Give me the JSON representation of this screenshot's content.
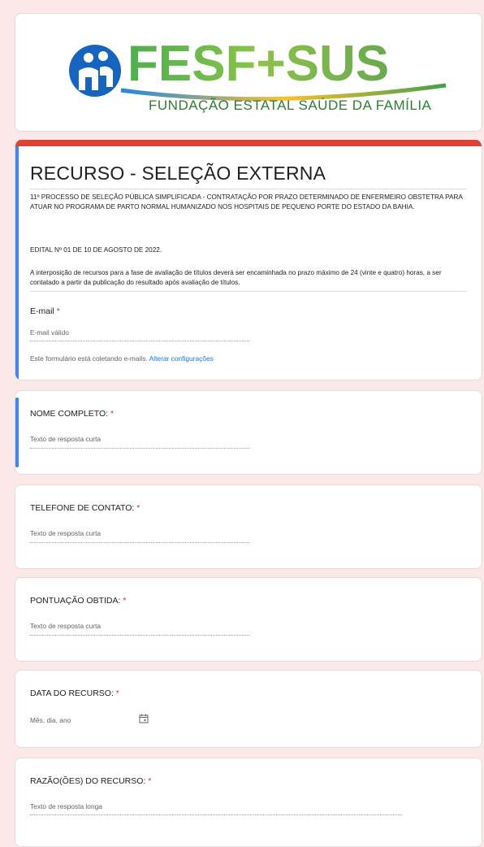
{
  "header": {
    "logo_text": "FESF+SUS",
    "logo_subtitle": "FUNDAÇÃO ESTATAL SAÚDE DA FAMÍLIA"
  },
  "form": {
    "title": "RECURSO - SELEÇÃO EXTERNA",
    "description_1": "11º PROCESSO DE SELEÇÃO PÚBLICA SIMPLIFICADA - CONTRATAÇÃO POR PRAZO DETERMINADO DE ENFERMEIRO OBSTETRA PARA ATUAR NO PROGRAMA DE PARTO NORMAL HUMANIZADO NOS HOSPITAIS DE PEQUENO PORTE DO ESTADO DA BAHIA.",
    "description_2": "EDITAL Nº 01 DE 10 DE AGOSTO DE 2022.",
    "description_3": "A interposição de recursos para a fase de avaliação de títulos deverá ser encaminhada no prazo máximo de 24 (vinte e quatro) horas, a ser contatado a partir da publicação do resultado após avaliação de títulos.",
    "email_label": "E-mail",
    "email_placeholder": "E-mail válido",
    "collecting_note": "Este formulário está coletando e-mails.",
    "change_settings": "Alterar configurações",
    "required_mark": "*"
  },
  "questions": [
    {
      "label": "NOME COMPLETO:",
      "placeholder": "Texto de resposta curta"
    },
    {
      "label": "TELEFONE DE CONTATO:",
      "placeholder": "Texto de resposta curta"
    },
    {
      "label": "PONTUAÇÃO OBTIDA:",
      "placeholder": "Texto de resposta curta"
    },
    {
      "label": "DATA DO RECURSO:",
      "placeholder": "Mês, dia, ano"
    },
    {
      "label": "RAZÃO(ÕES) DO RECURSO:",
      "placeholder": "Texto de resposta longa"
    }
  ],
  "colors": {
    "accent_red": "#db4437",
    "accent_blue": "#4285f4",
    "link_blue": "#1a73e8"
  }
}
